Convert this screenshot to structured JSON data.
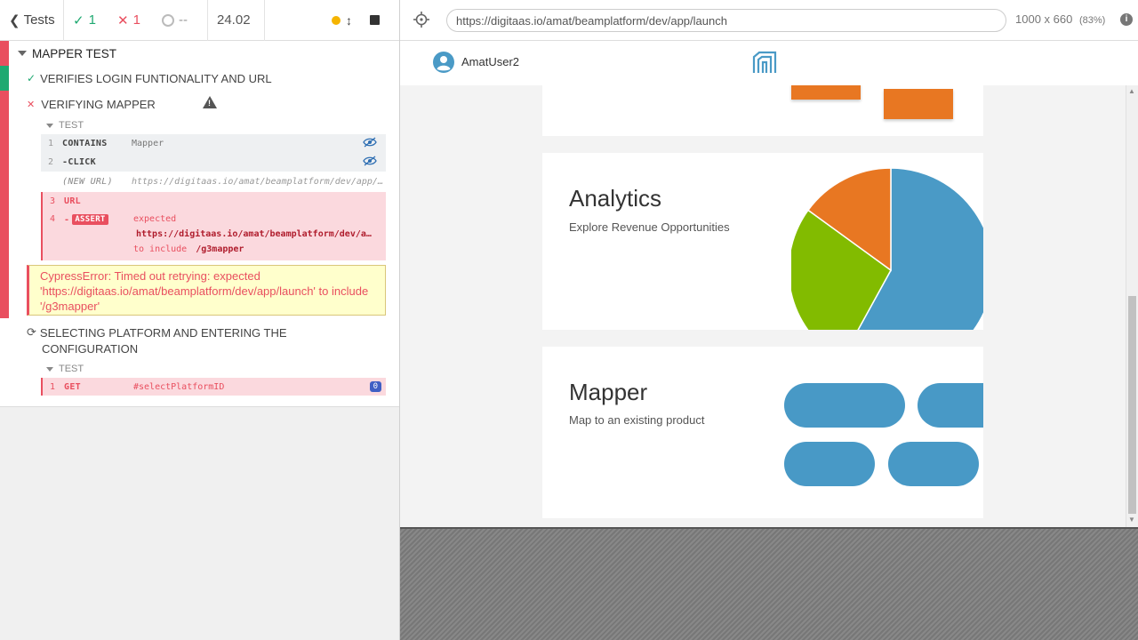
{
  "reporter": {
    "header": {
      "tests_label": "Tests",
      "passed_count": "1",
      "failed_count": "1",
      "pending_count": "--",
      "duration": "24.02"
    },
    "suite_title": "MAPPER TEST",
    "tests": [
      {
        "title": "VERIFIES LOGIN FUNTIONALITY AND URL"
      },
      {
        "title": "VERIFYING MAPPER"
      },
      {
        "title_line1": "SELECTING PLATFORM AND ENTERING THE",
        "title_line2": "CONFIGURATION"
      }
    ],
    "hook_label": "TEST",
    "commands_test2": [
      {
        "num": "1",
        "name": "CONTAINS",
        "message": "Mapper"
      },
      {
        "num": "2",
        "name": "-CLICK",
        "message": ""
      },
      {
        "num": "",
        "name": "(NEW URL)",
        "message": "https://digitaas.io/amat/beamplatform/dev/app/launch"
      },
      {
        "num": "3",
        "name": "URL",
        "message": ""
      },
      {
        "num": "4",
        "name": "-",
        "badge": "ASSERT",
        "message": "expected",
        "message_url": "https://digitaas.io/amat/beamplatform/dev/app/launch",
        "message_to_include": "to include",
        "message_value": "/g3mapper"
      }
    ],
    "error_message": "CypressError: Timed out retrying: expected 'https://digitaas.io/amat/beamplatform/dev/app/launch' to include '/g3mapper'",
    "commands_test3": [
      {
        "num": "1",
        "name": "GET",
        "message": "#selectPlatformID",
        "badge": "0"
      }
    ]
  },
  "aut": {
    "url": "https://digitaas.io/amat/beamplatform/dev/app/launch",
    "viewport": "1000 x 660",
    "zoom": "(83%)",
    "user_name": "AmatUser2",
    "cards": [
      {
        "title": "Analytics",
        "subtitle": "Explore Revenue Opportunities"
      },
      {
        "title": "Mapper",
        "subtitle": "Map to an existing product"
      }
    ]
  },
  "colors": {
    "pass": "#1fa971",
    "fail": "#e94f5f",
    "pill_blue": "#4899c6",
    "orange": "#e87722",
    "green": "#82bb00",
    "pie_blue": "#4a9ac6"
  },
  "chart_data": {
    "type": "pie",
    "slices": [
      {
        "color": "#4a9ac6",
        "value": 58
      },
      {
        "color": "#82bb00",
        "value": 27
      },
      {
        "color": "#e87722",
        "value": 15
      }
    ]
  }
}
